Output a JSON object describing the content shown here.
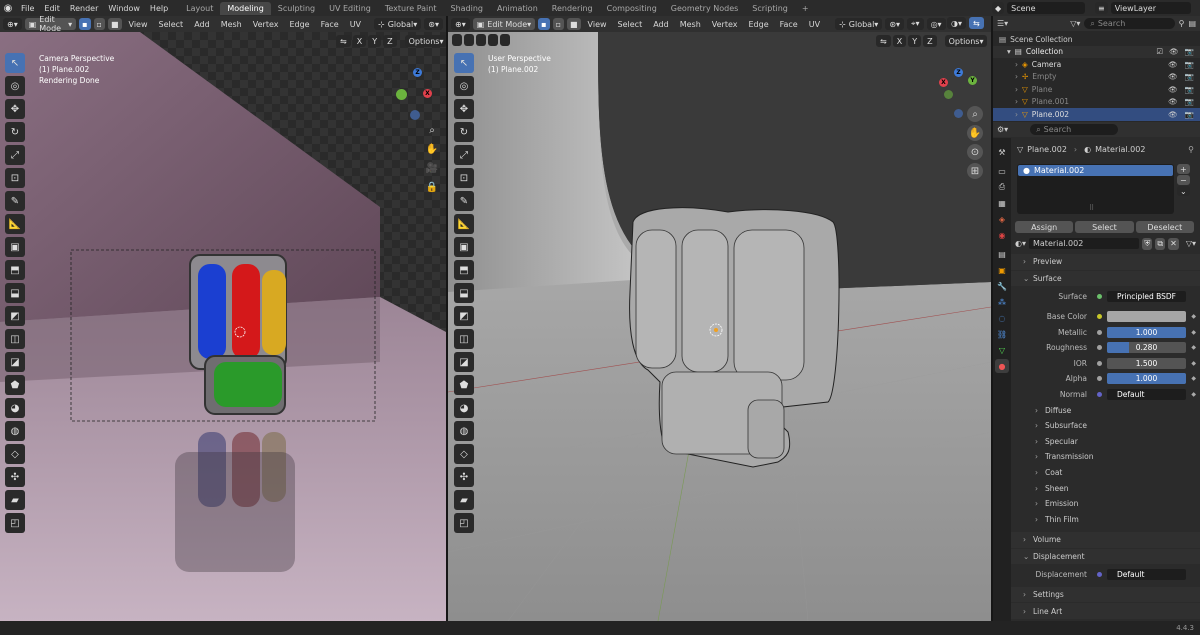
{
  "topbar": {
    "menus": [
      "File",
      "Edit",
      "Render",
      "Window",
      "Help"
    ],
    "workspaces": [
      "Layout",
      "Modeling",
      "Sculpting",
      "UV Editing",
      "Texture Paint",
      "Shading",
      "Animation",
      "Rendering",
      "Compositing",
      "Geometry Nodes",
      "Scripting"
    ],
    "active_workspace": "Modeling",
    "add_tab": "+",
    "scene": "Scene",
    "view_layer": "ViewLayer"
  },
  "viewport_left": {
    "mode": "Edit Mode",
    "menus": [
      "View",
      "Select",
      "Add",
      "Mesh",
      "Vertex",
      "Edge",
      "Face",
      "UV"
    ],
    "orientation": "Global",
    "axes": [
      "X",
      "Y",
      "Z"
    ],
    "options": "Options",
    "overlay_lines": [
      "Camera Perspective",
      "(1) Plane.002",
      "Rendering Done"
    ]
  },
  "viewport_right": {
    "mode": "Edit Mode",
    "menus": [
      "View",
      "Select",
      "Add",
      "Mesh",
      "Vertex",
      "Edge",
      "Face",
      "UV"
    ],
    "orientation": "Global",
    "axes": [
      "X",
      "Y",
      "Z"
    ],
    "options": "Options",
    "overlay_lines": [
      "User Perspective",
      "(1) Plane.002"
    ]
  },
  "gizmo": {
    "x": "X",
    "y": "Y",
    "z": "Z",
    "x_color": "#e0404c",
    "y_color": "#6bb33e",
    "z_color": "#3d7ad8"
  },
  "outliner": {
    "search_placeholder": "Search",
    "root": "Scene Collection",
    "collection": "Collection",
    "items": [
      {
        "name": "Camera",
        "dim": false,
        "selected": false
      },
      {
        "name": "Empty",
        "dim": true,
        "selected": false
      },
      {
        "name": "Plane",
        "dim": true,
        "selected": false
      },
      {
        "name": "Plane.001",
        "dim": true,
        "selected": false
      },
      {
        "name": "Plane.002",
        "dim": false,
        "selected": true
      }
    ]
  },
  "properties": {
    "search_placeholder": "Search",
    "breadcrumb_object": "Plane.002",
    "breadcrumb_material": "Material.002",
    "slot": "Material.002",
    "assign": "Assign",
    "select": "Select",
    "deselect": "Deselect",
    "material_name": "Material.002",
    "preview": "Preview",
    "surface_section": "Surface",
    "surface_label": "Surface",
    "surface_value": "Principled BSDF",
    "fields": [
      {
        "label": "Base Color",
        "value": "",
        "fill": 1.0,
        "kind": "color",
        "socket": "#c7c729"
      },
      {
        "label": "Metallic",
        "value": "1.000",
        "fill": 1.0,
        "kind": "slider",
        "socket": "#a1a1a1"
      },
      {
        "label": "Roughness",
        "value": "0.280",
        "fill": 0.28,
        "kind": "slider",
        "socket": "#a1a1a1"
      },
      {
        "label": "IOR",
        "value": "1.500",
        "fill": 0.0,
        "kind": "slider",
        "socket": "#a1a1a1"
      },
      {
        "label": "Alpha",
        "value": "1.000",
        "fill": 1.0,
        "kind": "slider",
        "socket": "#a1a1a1"
      },
      {
        "label": "Normal",
        "value": "Default",
        "fill": 0.0,
        "kind": "dark",
        "socket": "#6363c7"
      }
    ],
    "subpanels": [
      "Diffuse",
      "Subsurface",
      "Specular",
      "Transmission",
      "Coat",
      "Sheen",
      "Emission",
      "Thin Film"
    ],
    "volume": "Volume",
    "displacement_section": "Displacement",
    "displacement_label": "Displacement",
    "displacement_value": "Default",
    "settings": "Settings",
    "line_art": "Line Art"
  },
  "status": {
    "version": "4.4.3"
  }
}
